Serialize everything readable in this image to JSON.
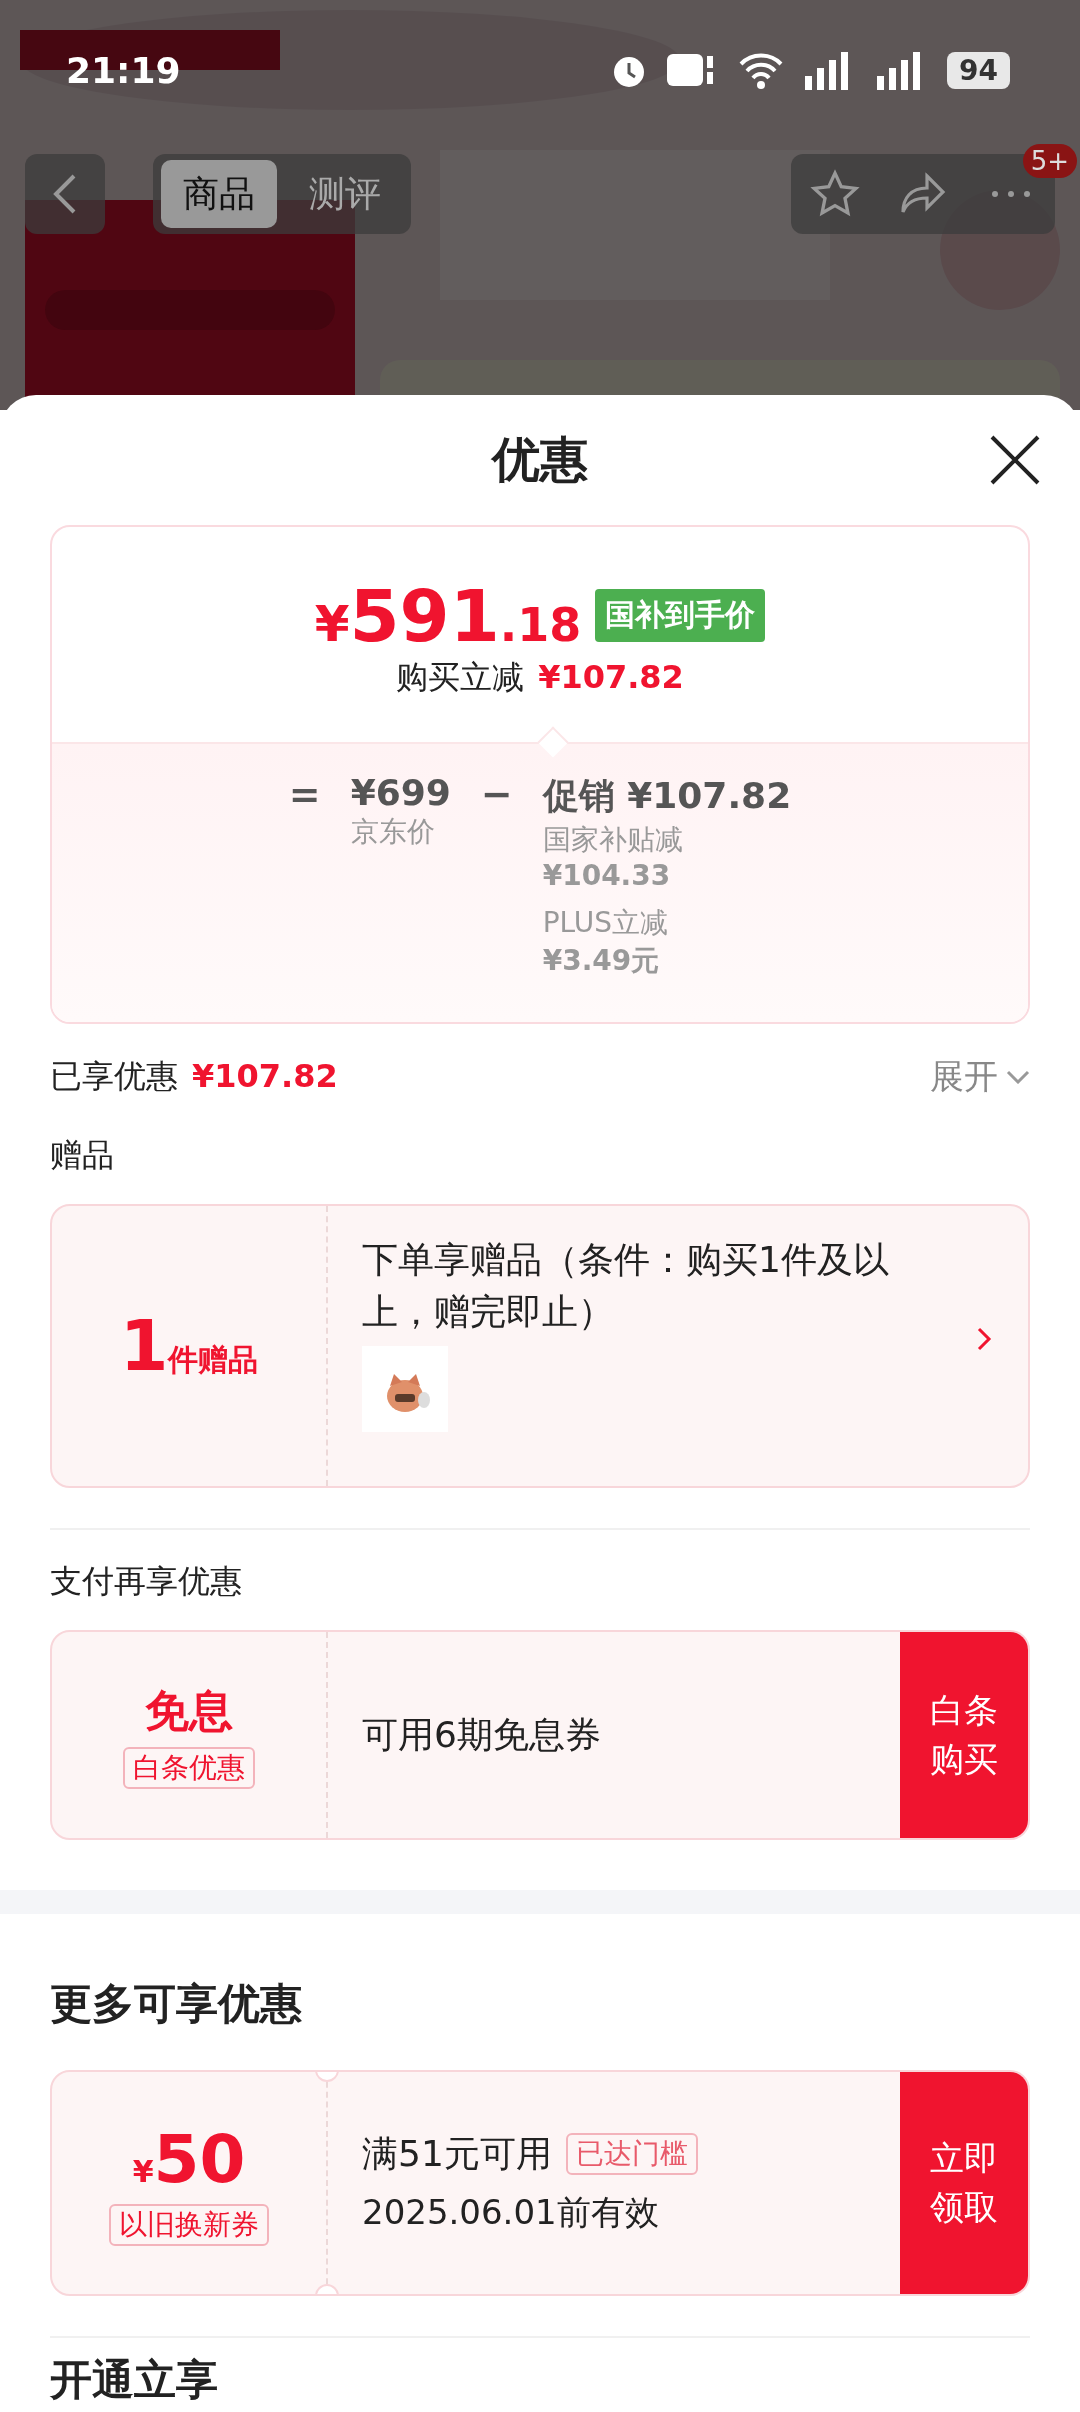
{
  "status_bar": {
    "time": "21:19",
    "battery": "94"
  },
  "nav": {
    "tabs": [
      {
        "label": "商品",
        "selected": true
      },
      {
        "label": "测评",
        "selected": false
      }
    ],
    "badge": "5+"
  },
  "sheet": {
    "title": "优惠",
    "price": {
      "symbol": "¥",
      "integer": "591",
      "decimal": ".18",
      "tag": "国补到手价",
      "saving_label": "购买立减",
      "saving_value": "¥107.82"
    },
    "breakdown": {
      "equals": "=",
      "base_price": "¥699",
      "base_label": "京东价",
      "minus": "−",
      "promo": "促销 ¥107.82",
      "items": [
        {
          "label": "国家补贴减",
          "value": "¥104.33"
        },
        {
          "label": "PLUS立减",
          "value": "¥3.49元"
        }
      ]
    },
    "enjoyed": {
      "label": "已享优惠",
      "value": "¥107.82",
      "toggle": "展开",
      "expanded": false
    },
    "gifts": {
      "title": "赠品",
      "count": "1",
      "unit": "件赠品",
      "text": "下单享赠品（条件：购买1件及以上，赠完即止）"
    },
    "payment": {
      "title": "支付再享优惠",
      "headline": "免息",
      "tag": "白条优惠",
      "text": "可用6期免息券",
      "action": "白条购买"
    },
    "more": {
      "title": "更多可享优惠",
      "coupons": [
        {
          "symbol": "¥",
          "amount": "50",
          "tag": "以旧换新券",
          "condition": "满51元可用",
          "badge": "已达门槛",
          "validity": "2025.06.01前有效",
          "action": "立即领取"
        }
      ]
    },
    "next_section": {
      "title": "开通立享"
    }
  }
}
